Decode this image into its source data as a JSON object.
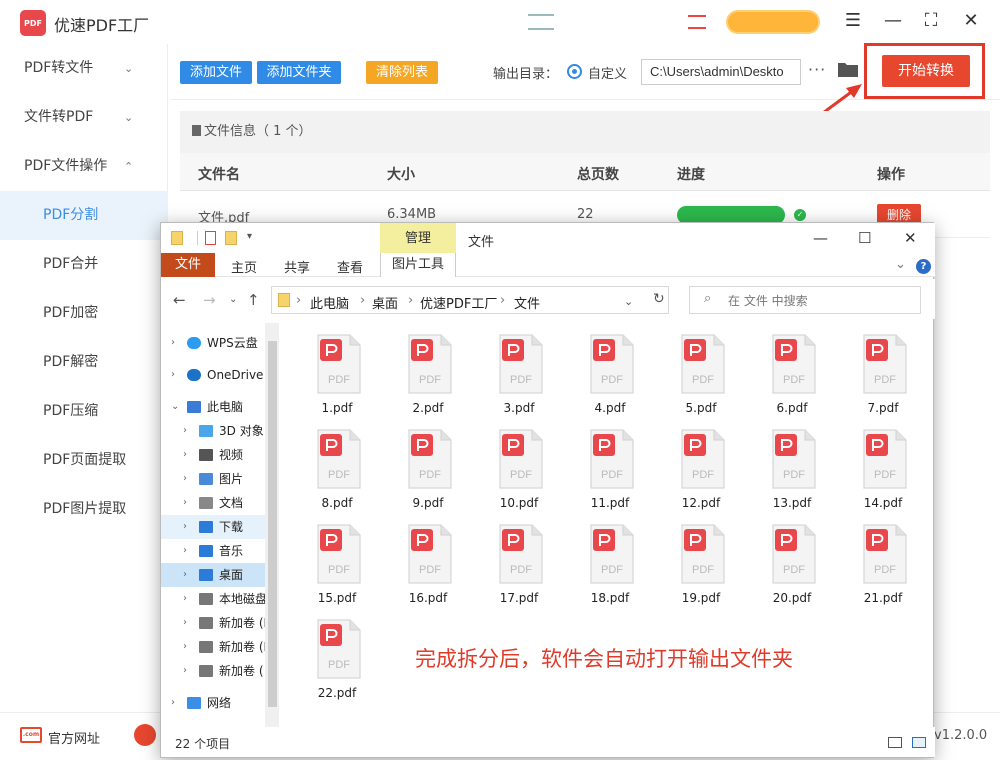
{
  "app": {
    "title": "优速PDF工厂",
    "logo_text": "PDF",
    "version": "v1.2.0.0"
  },
  "sidebar": {
    "items": [
      {
        "label": "PDF转文件",
        "chev": "⌄"
      },
      {
        "label": "文件转PDF",
        "chev": "⌄"
      },
      {
        "label": "PDF文件操作",
        "chev": "⌃"
      },
      {
        "label": "PDF分割"
      },
      {
        "label": "PDF合并"
      },
      {
        "label": "PDF加密"
      },
      {
        "label": "PDF解密"
      },
      {
        "label": "PDF压缩"
      },
      {
        "label": "PDF页面提取"
      },
      {
        "label": "PDF图片提取"
      }
    ]
  },
  "toolbar": {
    "add_file": "添加文件",
    "add_folder": "添加文件夹",
    "clear_list": "清除列表",
    "output_label": "输出目录：",
    "custom_label": "自定义",
    "path_value": "C:\\Users\\admin\\Deskto",
    "dots": "···",
    "start_label": "开始转换"
  },
  "file_panel": {
    "info": "文件信息（ 1 个）",
    "headers": {
      "name": "文件名",
      "size": "大小",
      "pages": "总页数",
      "progress": "进度",
      "action": "操作"
    },
    "row": {
      "name": "文件.pdf",
      "size": "6.34MB",
      "pages": "22",
      "progress": 1.0,
      "delete": "删除"
    }
  },
  "bottom": {
    "site_label": "官方网址",
    "site_icon": ".com"
  },
  "explorer": {
    "manage_tab": "管理",
    "file_title": "文件",
    "tabs": [
      "文件",
      "主页",
      "共享",
      "查看"
    ],
    "picture_tools": "图片工具",
    "breadcrumb": [
      "此电脑",
      "桌面",
      "优速PDF工厂",
      "文件"
    ],
    "search_placeholder": "在 文件 中搜索",
    "tree": [
      {
        "label": "WPS云盘",
        "icon": "cloud-icon"
      },
      {
        "label": "OneDrive",
        "icon": "onedrive-icon"
      },
      {
        "label": "此电脑",
        "icon": "computer-icon"
      },
      {
        "label": "3D 对象",
        "icon": "cube-icon"
      },
      {
        "label": "视频",
        "icon": "video-icon"
      },
      {
        "label": "图片",
        "icon": "picture-icon"
      },
      {
        "label": "文档",
        "icon": "document-icon"
      },
      {
        "label": "下载",
        "icon": "download-icon"
      },
      {
        "label": "音乐",
        "icon": "music-icon"
      },
      {
        "label": "桌面",
        "icon": "desktop-icon"
      },
      {
        "label": "本地磁盘",
        "icon": "disk-icon"
      },
      {
        "label": "新加卷 (I",
        "icon": "disk-icon"
      },
      {
        "label": "新加卷 (I",
        "icon": "disk-icon"
      },
      {
        "label": "新加卷 (",
        "icon": "disk-icon"
      },
      {
        "label": "网络",
        "icon": "network-icon"
      }
    ],
    "files": [
      "1.pdf",
      "2.pdf",
      "3.pdf",
      "4.pdf",
      "5.pdf",
      "6.pdf",
      "7.pdf",
      "8.pdf",
      "9.pdf",
      "10.pdf",
      "11.pdf",
      "12.pdf",
      "13.pdf",
      "14.pdf",
      "15.pdf",
      "16.pdf",
      "17.pdf",
      "18.pdf",
      "19.pdf",
      "20.pdf",
      "21.pdf",
      "22.pdf"
    ],
    "doc_label": "PDF",
    "note": "完成拆分后，软件会自动打开输出文件夹",
    "status": "22 个项目"
  },
  "colors": {
    "accent": "#2f8be6",
    "danger": "#e8472f",
    "orange": "#f5a623",
    "success": "#2db84d",
    "pdf_red": "#e8474c"
  }
}
